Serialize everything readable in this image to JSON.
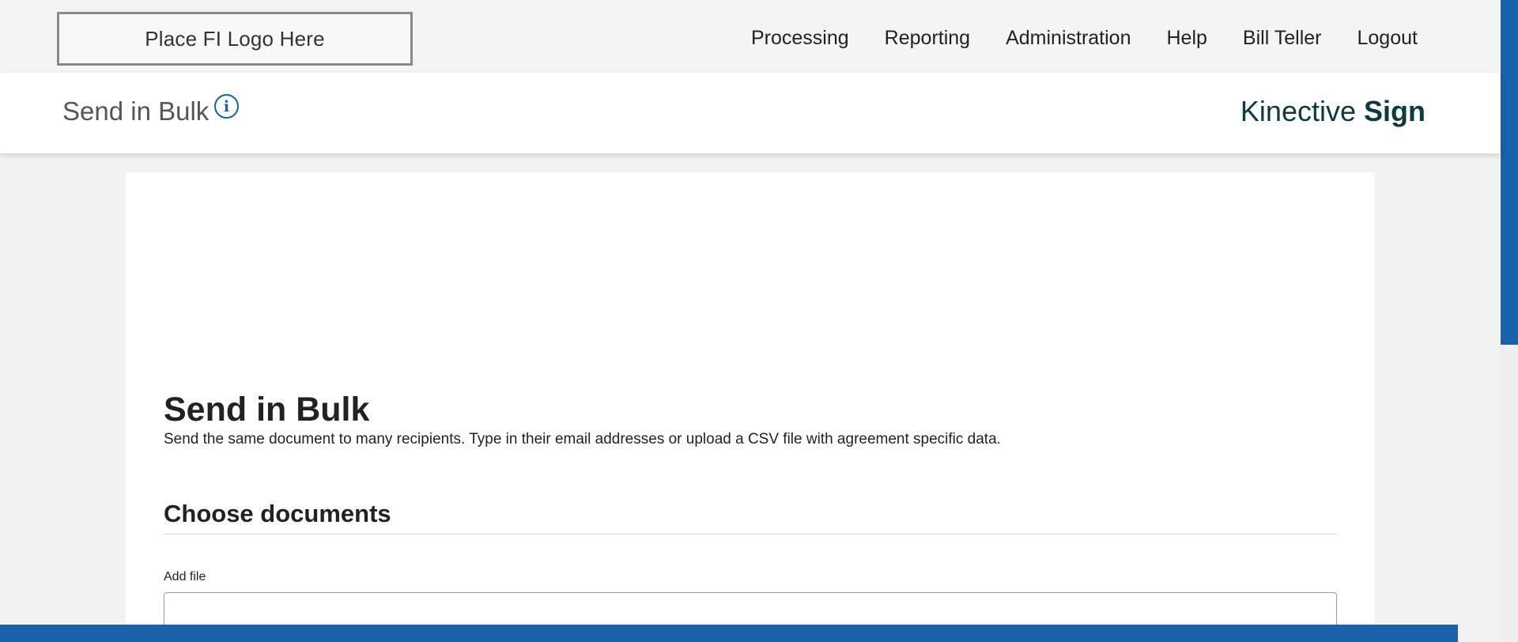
{
  "header": {
    "logo_text": "Place FI Logo Here",
    "nav": [
      {
        "label": "Processing"
      },
      {
        "label": "Reporting"
      },
      {
        "label": "Administration"
      },
      {
        "label": "Help"
      },
      {
        "label": "Bill Teller"
      },
      {
        "label": "Logout"
      }
    ]
  },
  "subheader": {
    "title": "Send in Bulk",
    "info_icon": "info-icon",
    "brand_light": "Kinective ",
    "brand_bold": "Sign"
  },
  "main": {
    "title": "Send in Bulk",
    "description": "Send the same document to many recipients. Type in their email addresses or upload a CSV file with agreement specific data.",
    "section_title": "Choose documents",
    "add_file_label": "Add file",
    "add_file_value": ""
  },
  "colors": {
    "accent_blue": "#1961a8",
    "brand_dark": "#0c3b3b",
    "page_bg": "#f2f2f2"
  }
}
